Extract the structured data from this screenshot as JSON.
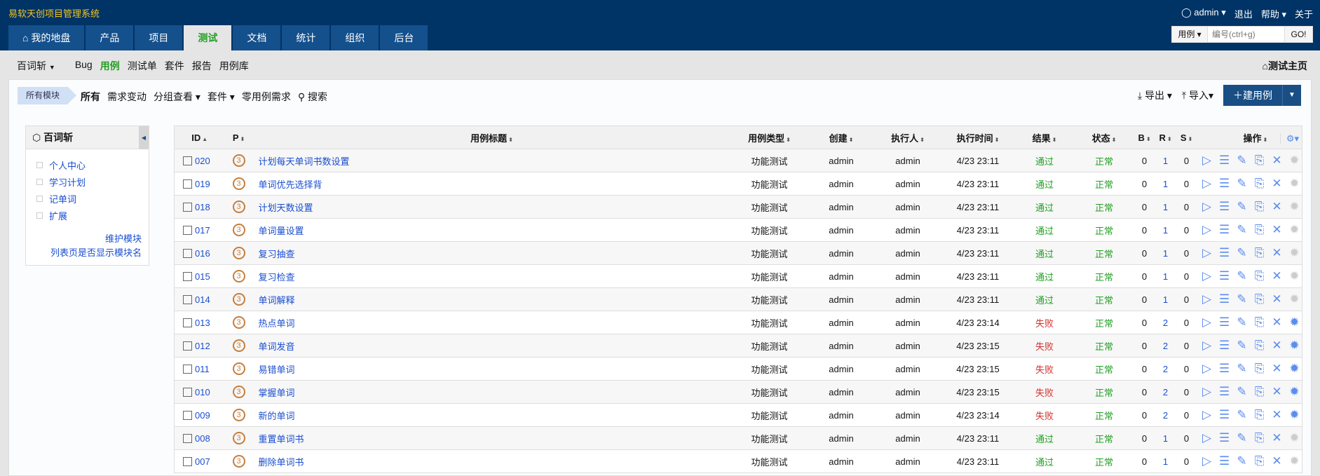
{
  "app": {
    "title": "易软天创项目管理系统"
  },
  "nav": {
    "tabs": [
      {
        "label": "我的地盘",
        "icon": "home-icon"
      },
      {
        "label": "产品"
      },
      {
        "label": "项目"
      },
      {
        "label": "测试",
        "active": true
      },
      {
        "label": "文档"
      },
      {
        "label": "统计"
      },
      {
        "label": "组织"
      },
      {
        "label": "后台"
      }
    ]
  },
  "user": {
    "name": "admin",
    "logout": "退出",
    "help": "帮助",
    "about": "关于"
  },
  "quicksearch": {
    "type": "用例",
    "placeholder": "编号(ctrl+g)",
    "go": "GO!"
  },
  "subnav": {
    "product": "百词斩",
    "items": [
      "Bug",
      "用例",
      "测试单",
      "套件",
      "报告",
      "用例库"
    ],
    "active": "用例",
    "home": "测试主页"
  },
  "toolbar": {
    "module_tag": "所有模块",
    "filters": [
      "所有",
      "需求变动",
      "分组查看",
      "套件",
      "零用例需求",
      "搜索"
    ],
    "export": "导出",
    "import": "导入",
    "new_case": "建用例"
  },
  "sidebar": {
    "title": "百词斩",
    "modules": [
      "个人中心",
      "学习计划",
      "记单词",
      "扩展"
    ],
    "links": [
      "维护模块",
      "列表页是否显示模块名"
    ]
  },
  "table": {
    "headers": {
      "id": "ID",
      "p": "P",
      "title": "用例标题",
      "type": "用例类型",
      "creator": "创建",
      "executor": "执行人",
      "time": "执行时间",
      "result": "结果",
      "status": "状态",
      "b": "B",
      "r": "R",
      "s": "S",
      "ops": "操作"
    },
    "rows": [
      {
        "id": "020",
        "p": "3",
        "title": "计划每天单词书数设置",
        "type": "功能测试",
        "creator": "admin",
        "executor": "admin",
        "time": "4/23 23:11",
        "result": "通过",
        "status": "正常",
        "b": "0",
        "r": "1",
        "s": "0"
      },
      {
        "id": "019",
        "p": "3",
        "title": "单词优先选择背",
        "type": "功能测试",
        "creator": "admin",
        "executor": "admin",
        "time": "4/23 23:11",
        "result": "通过",
        "status": "正常",
        "b": "0",
        "r": "1",
        "s": "0"
      },
      {
        "id": "018",
        "p": "3",
        "title": "计划天数设置",
        "type": "功能测试",
        "creator": "admin",
        "executor": "admin",
        "time": "4/23 23:11",
        "result": "通过",
        "status": "正常",
        "b": "0",
        "r": "1",
        "s": "0"
      },
      {
        "id": "017",
        "p": "3",
        "title": "单词量设置",
        "type": "功能测试",
        "creator": "admin",
        "executor": "admin",
        "time": "4/23 23:11",
        "result": "通过",
        "status": "正常",
        "b": "0",
        "r": "1",
        "s": "0"
      },
      {
        "id": "016",
        "p": "3",
        "title": "复习抽查",
        "type": "功能测试",
        "creator": "admin",
        "executor": "admin",
        "time": "4/23 23:11",
        "result": "通过",
        "status": "正常",
        "b": "0",
        "r": "1",
        "s": "0"
      },
      {
        "id": "015",
        "p": "3",
        "title": "复习检查",
        "type": "功能测试",
        "creator": "admin",
        "executor": "admin",
        "time": "4/23 23:11",
        "result": "通过",
        "status": "正常",
        "b": "0",
        "r": "1",
        "s": "0"
      },
      {
        "id": "014",
        "p": "3",
        "title": "单词解释",
        "type": "功能测试",
        "creator": "admin",
        "executor": "admin",
        "time": "4/23 23:11",
        "result": "通过",
        "status": "正常",
        "b": "0",
        "r": "1",
        "s": "0"
      },
      {
        "id": "013",
        "p": "3",
        "title": "热点单词",
        "type": "功能测试",
        "creator": "admin",
        "executor": "admin",
        "time": "4/23 23:14",
        "result": "失败",
        "status": "正常",
        "b": "0",
        "r": "2",
        "s": "0"
      },
      {
        "id": "012",
        "p": "3",
        "title": "单词发音",
        "type": "功能测试",
        "creator": "admin",
        "executor": "admin",
        "time": "4/23 23:15",
        "result": "失败",
        "status": "正常",
        "b": "0",
        "r": "2",
        "s": "0"
      },
      {
        "id": "011",
        "p": "3",
        "title": "易错单词",
        "type": "功能测试",
        "creator": "admin",
        "executor": "admin",
        "time": "4/23 23:15",
        "result": "失败",
        "status": "正常",
        "b": "0",
        "r": "2",
        "s": "0"
      },
      {
        "id": "010",
        "p": "3",
        "title": "掌握单词",
        "type": "功能测试",
        "creator": "admin",
        "executor": "admin",
        "time": "4/23 23:15",
        "result": "失败",
        "status": "正常",
        "b": "0",
        "r": "2",
        "s": "0"
      },
      {
        "id": "009",
        "p": "3",
        "title": "新的单词",
        "type": "功能测试",
        "creator": "admin",
        "executor": "admin",
        "time": "4/23 23:14",
        "result": "失败",
        "status": "正常",
        "b": "0",
        "r": "2",
        "s": "0"
      },
      {
        "id": "008",
        "p": "3",
        "title": "重置单词书",
        "type": "功能测试",
        "creator": "admin",
        "executor": "admin",
        "time": "4/23 23:11",
        "result": "通过",
        "status": "正常",
        "b": "0",
        "r": "1",
        "s": "0"
      },
      {
        "id": "007",
        "p": "3",
        "title": "删除单词书",
        "type": "功能测试",
        "creator": "admin",
        "executor": "admin",
        "time": "4/23 23:11",
        "result": "通过",
        "status": "正常",
        "b": "0",
        "r": "1",
        "s": "0"
      }
    ]
  },
  "colors": {
    "header_bg": "#003366",
    "tab_bg": "#14508c",
    "accent_green": "#229f24",
    "fail_red": "#d2322d",
    "link_blue": "#1a4ed0",
    "brand_yellow": "#f3c623"
  }
}
